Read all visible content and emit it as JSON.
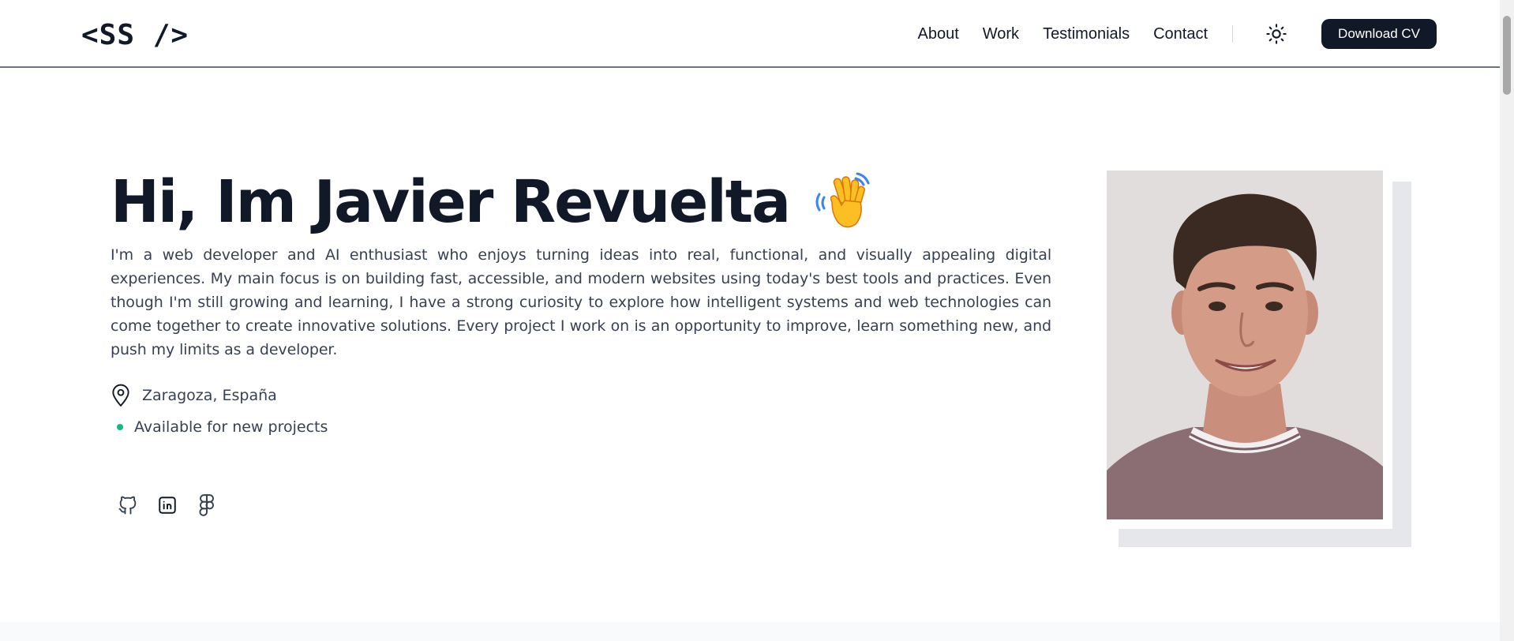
{
  "header": {
    "logo": "<SS />",
    "nav": [
      {
        "label": "About"
      },
      {
        "label": "Work"
      },
      {
        "label": "Testimonials"
      },
      {
        "label": "Contact"
      }
    ],
    "theme_toggle_icon": "sun-icon",
    "download_label": "Download CV"
  },
  "hero": {
    "title": "Hi, Im Javier Revuelta",
    "emoji": "waving-hand-icon",
    "description": "I'm a web developer and AI enthusiast who enjoys turning ideas into real, functional, and visually appealing digital experiences. My main focus is on building fast, accessible, and modern websites using today's best tools and practices. Even though I'm still growing and learning, I have a strong curiosity to explore how intelligent systems and web technologies can come together to create innovative solutions. Every project I work on is an opportunity to improve, learn something new, and push my limits as a developer.",
    "location": "Zaragoza, España",
    "availability": "Available for new projects",
    "socials": [
      {
        "icon": "github-icon"
      },
      {
        "icon": "linkedin-icon"
      },
      {
        "icon": "figma-icon"
      }
    ]
  },
  "colors": {
    "text_primary": "#111827",
    "text_secondary": "#374151",
    "button_bg": "#111827",
    "status_green": "#10b981",
    "photo_shadow": "#e5e7eb"
  }
}
